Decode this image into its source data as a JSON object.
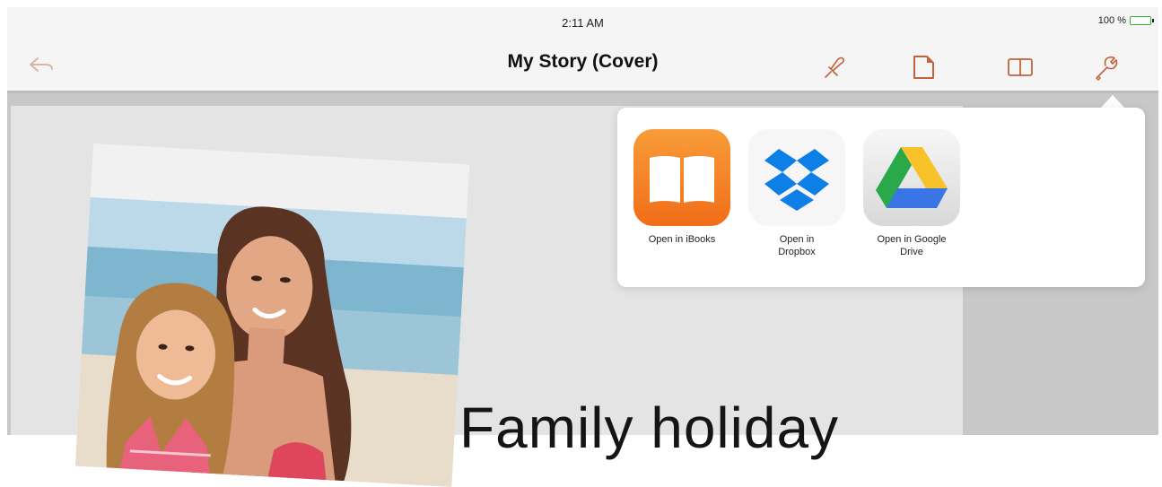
{
  "status_bar": {
    "time": "2:11 AM",
    "battery": "100 %",
    "battery_level": 1.0
  },
  "nav": {
    "title": "My Story (Cover)",
    "back_icon": "back-arrow-icon",
    "icons": [
      "pin-icon",
      "page-icon",
      "book-icon",
      "wrench-icon"
    ],
    "accent": "#c0633c"
  },
  "popover": {
    "items": [
      {
        "label": "Open in iBooks",
        "icon": "ibooks-icon"
      },
      {
        "label": "Open in Dropbox",
        "icon": "dropbox-icon"
      },
      {
        "label": "Open in Google Drive",
        "icon": "google-drive-icon"
      }
    ]
  },
  "page": {
    "heading": "Family holiday"
  },
  "colors": {
    "ibooks_orange": "#f47b20",
    "dropbox_blue": "#0d7fe6",
    "drive_green": "#2aa94b",
    "drive_yellow": "#f8c22a",
    "drive_blue": "#3a75e6"
  }
}
